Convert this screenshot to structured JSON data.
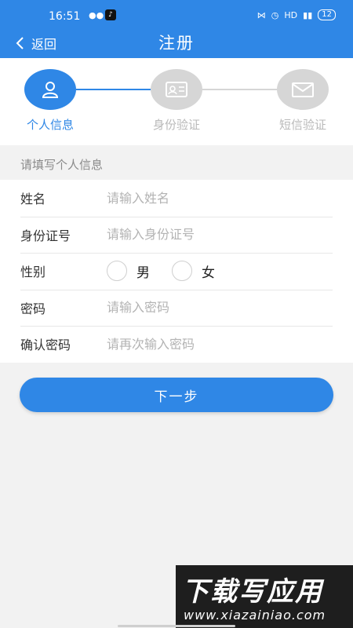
{
  "status_bar": {
    "time": "16:51",
    "network": "HD",
    "battery": "12"
  },
  "title_bar": {
    "back_label": "返回",
    "title": "注册"
  },
  "stepper": {
    "steps": [
      {
        "label": "个人信息",
        "icon": "person-icon",
        "state": "active"
      },
      {
        "label": "身份验证",
        "icon": "id-card-icon",
        "state": "inactive"
      },
      {
        "label": "短信验证",
        "icon": "envelope-icon",
        "state": "inactive"
      }
    ]
  },
  "section_header": "请填写个人信息",
  "form": {
    "name": {
      "label": "姓名",
      "placeholder": "请输入姓名",
      "value": ""
    },
    "id_number": {
      "label": "身份证号",
      "placeholder": "请输入身份证号",
      "value": ""
    },
    "gender": {
      "label": "性别",
      "options": [
        "男",
        "女"
      ],
      "selected": null
    },
    "password": {
      "label": "密码",
      "placeholder": "请输入密码",
      "value": ""
    },
    "confirm_password": {
      "label": "确认密码",
      "placeholder": "请再次输入密码",
      "value": ""
    }
  },
  "next_button": "下一步",
  "watermark": {
    "title": "下载写应用",
    "url": "www.xiazainiao.com"
  },
  "colors": {
    "primary": "#2f87e6",
    "inactive_step": "#d6d6d6",
    "page_bg": "#f2f2f2"
  }
}
